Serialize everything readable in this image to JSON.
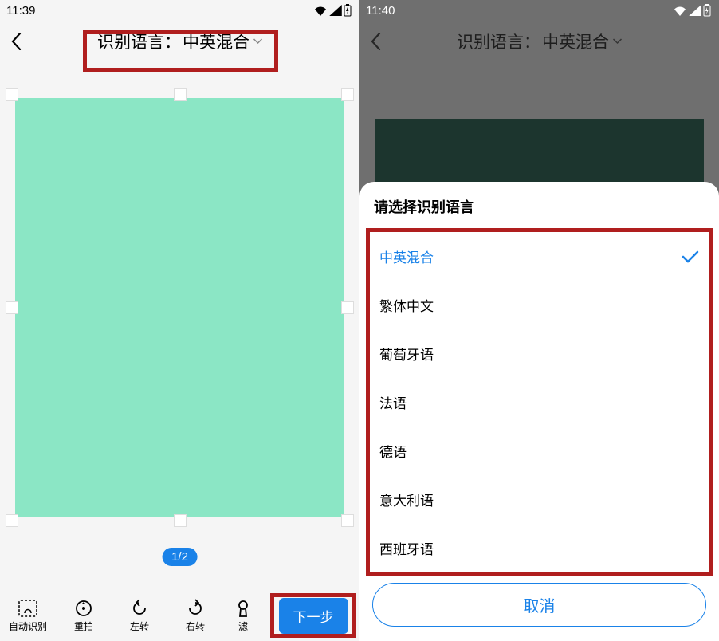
{
  "left": {
    "status_time": "11:39",
    "header_label": "识别语言：",
    "header_value": "中英混合",
    "page_indicator": "1/2",
    "toolbar": {
      "auto_detect": "自动识别",
      "retake": "重拍",
      "rotate_left": "左转",
      "rotate_right": "右转",
      "filter": "滤",
      "next": "下一步"
    }
  },
  "right": {
    "status_time": "11:40",
    "header_label": "识别语言：",
    "header_value": "中英混合",
    "sheet_title": "请选择识别语言",
    "options": [
      "中英混合",
      "繁体中文",
      "葡萄牙语",
      "法语",
      "德语",
      "意大利语",
      "西班牙语"
    ],
    "cancel": "取消"
  },
  "colors": {
    "accent": "#1a82e8",
    "highlight": "#b01e1e",
    "crop_bg": "#8be6c5"
  }
}
